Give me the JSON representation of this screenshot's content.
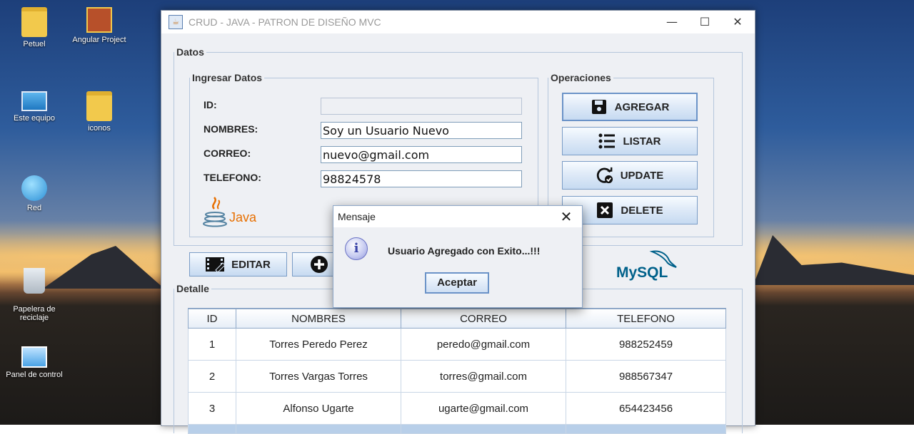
{
  "desktop": {
    "icons": [
      {
        "label": "Petuel"
      },
      {
        "label": "Angular Project"
      },
      {
        "label": "Este equipo"
      },
      {
        "label": "iconos"
      },
      {
        "label": "Red"
      },
      {
        "label": "Papelera de\nreciclaje"
      },
      {
        "label": "Panel de control"
      }
    ]
  },
  "window": {
    "title": "CRUD - JAVA - PATRON DE DISEÑO MVC",
    "controls": {
      "minimize": "—",
      "maximize": "☐",
      "close": "✕"
    }
  },
  "datos": {
    "legend": "Datos",
    "ingresar": {
      "legend": "Ingresar Datos",
      "id_label": "ID:",
      "id_value": "",
      "nombres_label": "NOMBRES:",
      "nombres_value": "Soy un Usuario Nuevo",
      "correo_label": "CORREO:",
      "correo_value": "nuevo@gmail.com",
      "telefono_label": "TELEFONO:",
      "telefono_value": "98824578",
      "java_logo_text": "Java"
    },
    "operaciones": {
      "legend": "Operaciones",
      "agregar": "AGREGAR",
      "listar": "LISTAR",
      "update": "UPDATE",
      "delete": "DELETE"
    }
  },
  "toolbar": {
    "editar": "EDITAR",
    "mysql_logo_text": "MySQL"
  },
  "detalle": {
    "legend": "Detalle",
    "columns": [
      "ID",
      "NOMBRES",
      "CORREO",
      "TELEFONO"
    ],
    "rows": [
      [
        "1",
        "Torres Peredo Perez",
        "peredo@gmail.com",
        "988252459"
      ],
      [
        "2",
        "Torres Vargas Torres",
        "torres@gmail.com",
        "988567347"
      ],
      [
        "3",
        "Alfonso Ugarte",
        "ugarte@gmail.com",
        "654423456"
      ]
    ]
  },
  "dialog": {
    "title": "Mensaje",
    "close": "✕",
    "icon_text": "i",
    "message": "Usuario Agregado con Exito...!!!",
    "ok_label": "Aceptar"
  },
  "colors": {
    "accent": "#6b93c8",
    "java_orange": "#e76f00",
    "mysql_blue": "#00618a"
  }
}
